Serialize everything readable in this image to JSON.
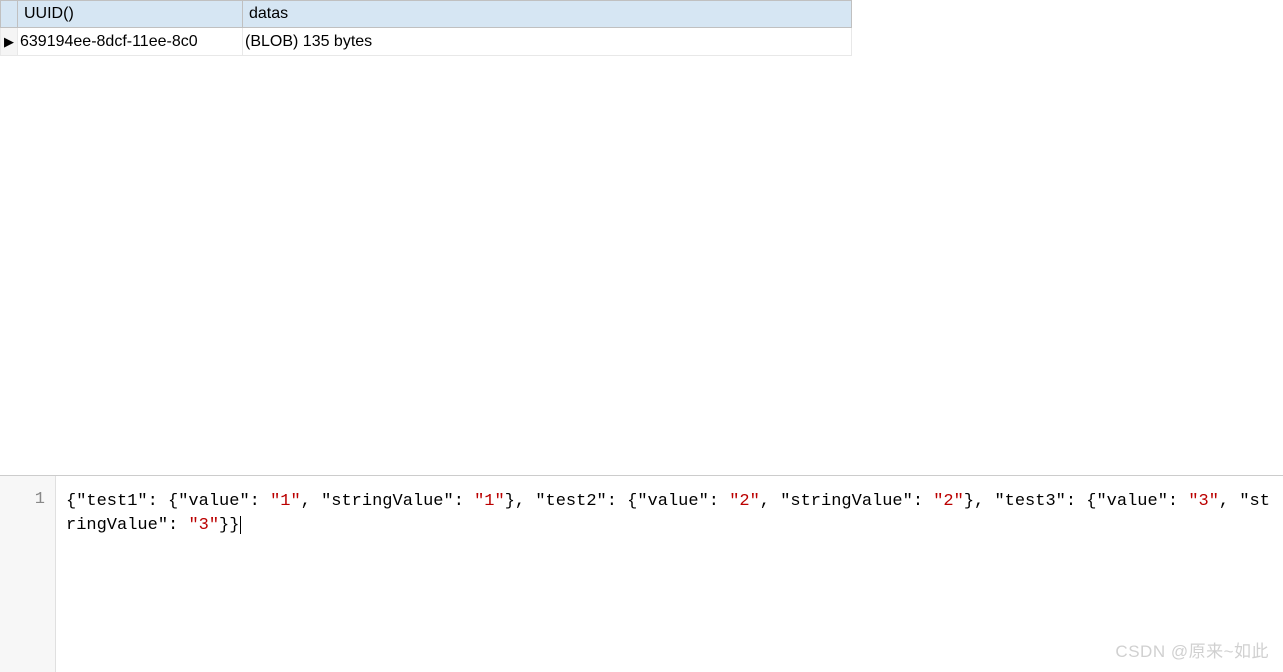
{
  "grid": {
    "headers": [
      "UUID()",
      "datas"
    ],
    "rows": [
      {
        "uuid": "639194ee-8dcf-11ee-8c0",
        "datas": "(BLOB) 135 bytes"
      }
    ]
  },
  "code": {
    "lineNumber": "1",
    "json_tokens": [
      {
        "t": "p",
        "v": "{"
      },
      {
        "t": "k",
        "v": "\"test1\""
      },
      {
        "t": "p",
        "v": ": {"
      },
      {
        "t": "k",
        "v": "\"value\""
      },
      {
        "t": "p",
        "v": ": "
      },
      {
        "t": "s",
        "v": "\"1\""
      },
      {
        "t": "p",
        "v": ", "
      },
      {
        "t": "k",
        "v": "\"stringValue\""
      },
      {
        "t": "p",
        "v": ": "
      },
      {
        "t": "s",
        "v": "\"1\""
      },
      {
        "t": "p",
        "v": "}, "
      },
      {
        "t": "k",
        "v": "\"test2\""
      },
      {
        "t": "p",
        "v": ": {"
      },
      {
        "t": "k",
        "v": "\"value\""
      },
      {
        "t": "p",
        "v": ": "
      },
      {
        "t": "s",
        "v": "\"2\""
      },
      {
        "t": "p",
        "v": ", "
      },
      {
        "t": "k",
        "v": "\"stringValue\""
      },
      {
        "t": "p",
        "v": ": "
      },
      {
        "t": "s",
        "v": "\"2\""
      },
      {
        "t": "p",
        "v": "}, "
      },
      {
        "t": "k",
        "v": "\"test3\""
      },
      {
        "t": "p",
        "v": ": {"
      },
      {
        "t": "k",
        "v": "\"value\""
      },
      {
        "t": "p",
        "v": ": "
      },
      {
        "t": "s",
        "v": "\"3\""
      },
      {
        "t": "p",
        "v": ", "
      },
      {
        "t": "k",
        "v": "\"stringValue\""
      },
      {
        "t": "p",
        "v": ": "
      },
      {
        "t": "s",
        "v": "\"3\""
      },
      {
        "t": "p",
        "v": "}}"
      }
    ]
  },
  "watermark": "CSDN @原来~如此"
}
